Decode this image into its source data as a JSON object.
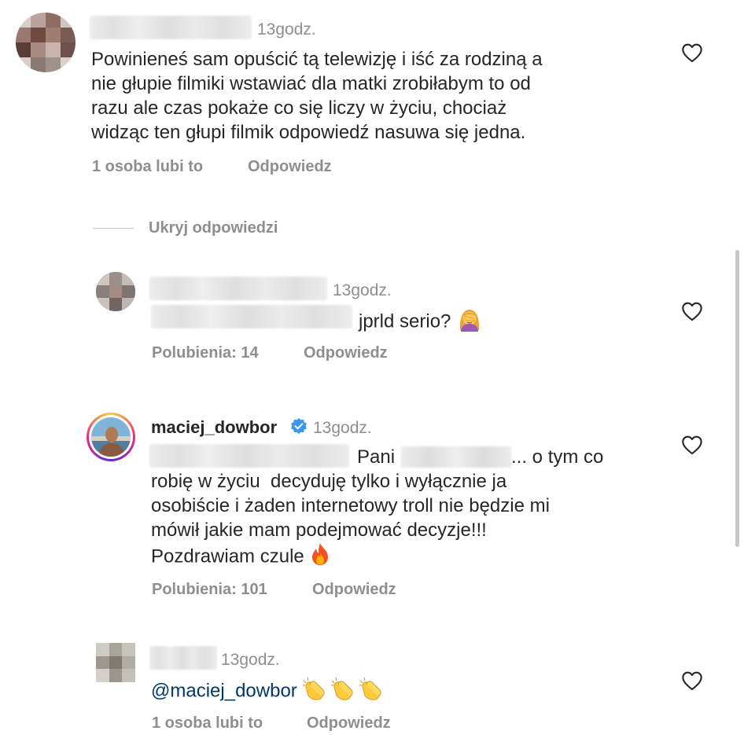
{
  "comments": [
    {
      "time": "13godz.",
      "text_lines": [
        "Powinieneś sam opuścić tą telewizję i iść za rodziną a",
        "nie głupie filmiki wstawiać dla matki zrobiłabym to od",
        "razu ale czas pokaże co się liczy w życiu, chociaż",
        "widząc ten głupi filmik odpowiedź nasuwa się jedna."
      ],
      "likes": "1 osoba lubi to",
      "reply": "Odpowiedz"
    }
  ],
  "hide_replies": "Ukryj odpowiedzi",
  "replies": [
    {
      "time": "13godz.",
      "text": "jprld serio?",
      "emoji": "woman-facepalming",
      "likes": "Polubienia: 14",
      "reply": "Odpowiedz"
    },
    {
      "username": "maciej_dowbor",
      "verified": true,
      "time": "13godz.",
      "line1_prefix": "Pani",
      "line1_suffix": "... o tym co",
      "text_lines": [
        "robię w życiu  decyduję tylko i wyłącznie ja",
        "osobiście i żaden internetowy troll nie będzie mi",
        "mówił jakie mam podejmować decyzje!!!",
        "Pozdrawiam czule"
      ],
      "emoji": "fire",
      "likes": "Polubienia: 101",
      "reply": "Odpowiedz"
    },
    {
      "time": "13godz.",
      "mention": "@maciej_dowbor",
      "emoji": "clapping-hands",
      "likes": "1 osoba lubi to",
      "reply": "Odpowiedz"
    }
  ],
  "colors": {
    "text": "#262626",
    "secondary": "#8e8e8e",
    "link": "#00376b",
    "verified": "#3897f0"
  }
}
